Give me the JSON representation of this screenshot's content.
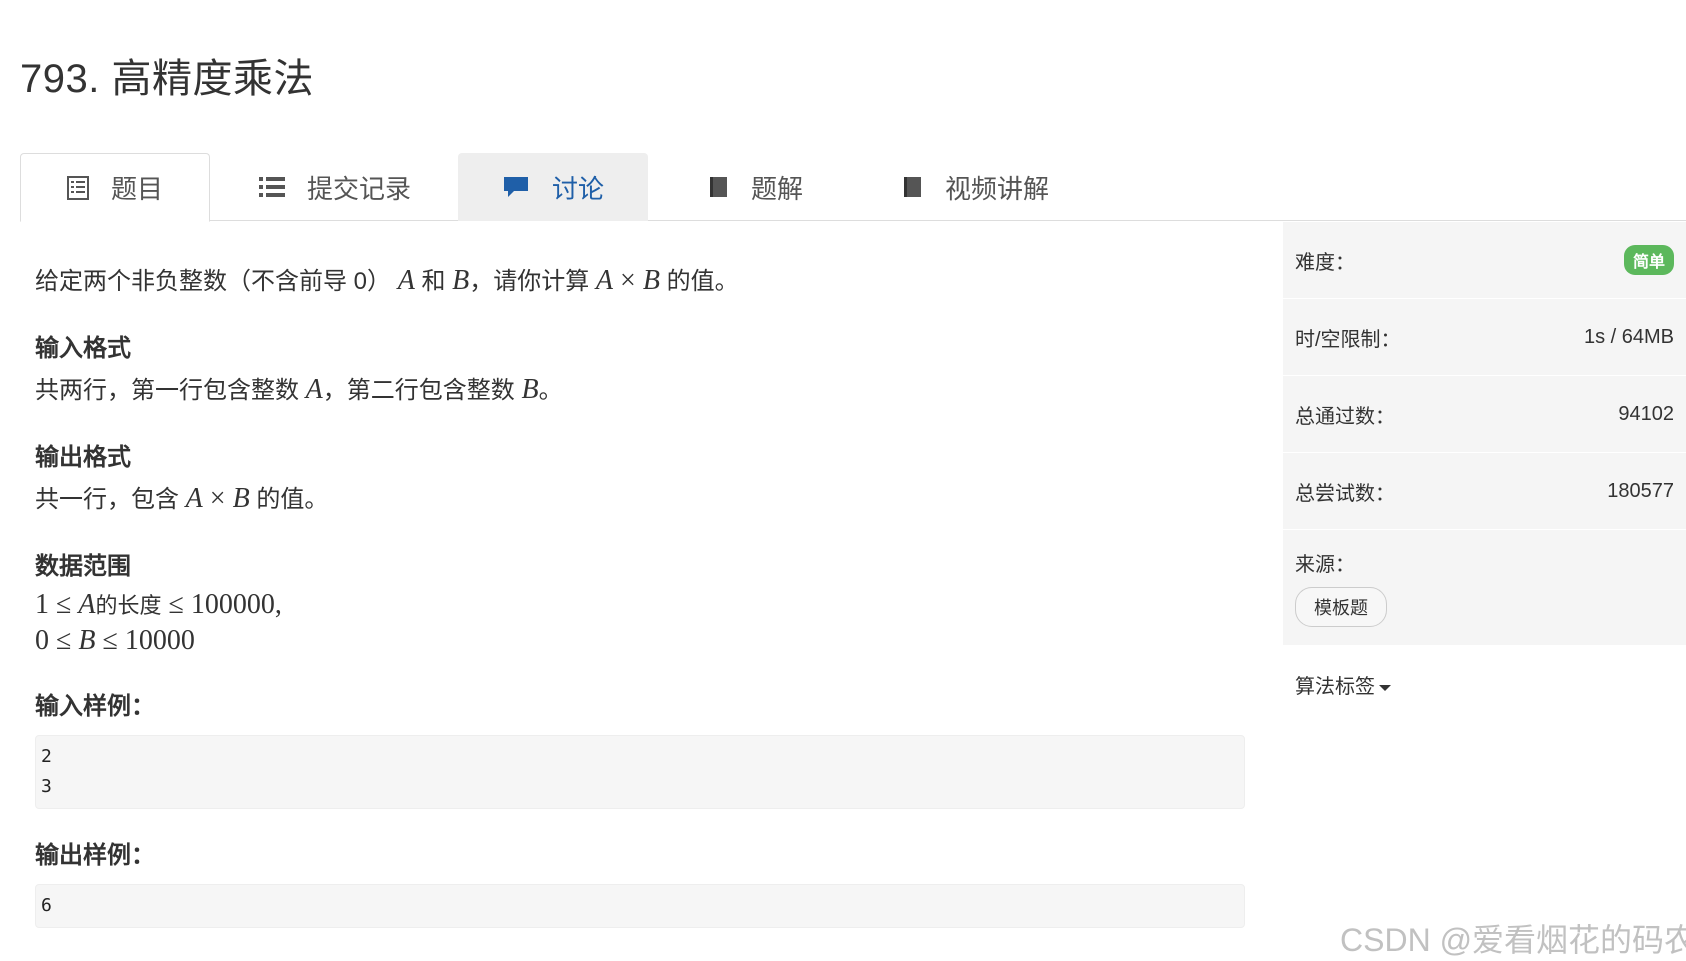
{
  "problem": {
    "title": "793. 高精度乘法"
  },
  "tabs": [
    {
      "label": "题目",
      "icon": "document-list-icon"
    },
    {
      "label": "提交记录",
      "icon": "list-icon"
    },
    {
      "label": "讨论",
      "icon": "comment-icon"
    },
    {
      "label": "题解",
      "icon": "book-icon"
    },
    {
      "label": "视频讲解",
      "icon": "book-icon"
    }
  ],
  "body": {
    "intro_a": "给定两个非负整数（不含前导 0）",
    "intro_b": "和",
    "intro_c": "，请你计算",
    "intro_d": "的值。",
    "var_a": "A",
    "var_b": "B",
    "times": "×",
    "input_heading": "输入格式",
    "input_a": "共两行，第一行包含整数",
    "input_b": "，第二行包含整数",
    "input_c": "。",
    "output_heading": "输出格式",
    "output_a": "共一行，包含",
    "output_b": "的值。",
    "range_heading": "数据范围",
    "range1_left": "1 ≤ ",
    "range1_mid": "的长度",
    "range1_right": " ≤ 100000,",
    "range2_left": "0 ≤ ",
    "range2_right": " ≤ 10000",
    "sample_in_heading": "输入样例：",
    "sample_in_line1": "2",
    "sample_in_line2": "3",
    "sample_out_heading": "输出样例：",
    "sample_out_line1": "6"
  },
  "sidebar": {
    "difficulty_label": "难度：",
    "difficulty_value": "简单",
    "limit_label": "时/空限制：",
    "limit_value": "1s / 64MB",
    "passed_label": "总通过数：",
    "passed_value": "94102",
    "tried_label": "总尝试数：",
    "tried_value": "180577",
    "source_label": "来源：",
    "source_tag": "模板题",
    "tags_label": "算法标签"
  },
  "watermark": "CSDN @爱看烟花的码农",
  "colors": {
    "easy_badge": "#5cb85c",
    "active_tab_bg": "#eeeeee",
    "accent": "#1f5fa8"
  }
}
